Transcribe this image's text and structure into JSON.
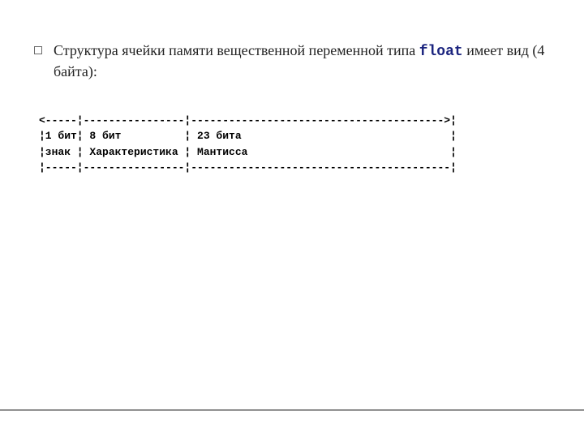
{
  "bullet": {
    "text_before": "Структура ячейки памяти вещественной переменной типа ",
    "type_keyword": "float",
    "text_after": " имеет вид (4 байта):"
  },
  "diagram": {
    "line1": "<-----¦----------------¦---------------------------------------->¦",
    "line2": "¦1 бит¦ 8 бит          ¦ 23 бита                                 ¦",
    "line3": "¦знак ¦ Характеристика ¦ Мантисса                                ¦",
    "line4": "¦-----¦----------------¦-----------------------------------------¦"
  }
}
